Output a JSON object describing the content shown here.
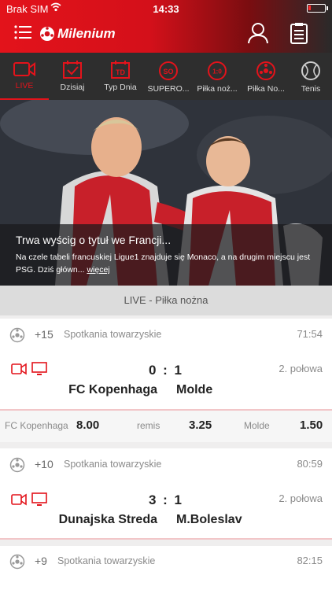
{
  "status": {
    "carrier": "Brak SIM",
    "time": "14:33",
    "battery_level": 0.15
  },
  "header": {
    "logo_text": "Milenium"
  },
  "colors": {
    "brand_red": "#e3131b",
    "dark_bar": "#2e2e2e",
    "card_bg": "#ffffff",
    "muted": "#8a8a8a"
  },
  "categories": [
    {
      "label": "LIVE",
      "icon": "video-camera-icon",
      "active": true
    },
    {
      "label": "Dzisiaj",
      "icon": "calendar-check-icon"
    },
    {
      "label": "Typ Dnia",
      "icon": "calendar-td-icon"
    },
    {
      "label": "SUPERO...",
      "icon": "so-badge-icon"
    },
    {
      "label": "Piłka noż...",
      "icon": "one-zero-badge-icon"
    },
    {
      "label": "Piłka No...",
      "icon": "soccer-ball-icon"
    },
    {
      "label": "Tenis",
      "icon": "tennis-ball-icon"
    }
  ],
  "hero": {
    "headline": "Trwa wyścig o tytuł we Francji...",
    "description": "Na czele tabeli francuskiej Ligue1 znajduje się Monaco, a na drugim miejscu jest PSG. Dziś główn...",
    "more_label": "więcej"
  },
  "section_title": "LIVE - Piłka nożna",
  "matches": [
    {
      "more_bets": "+15",
      "league": "Spotkania towarzyskie",
      "clock": "71:54",
      "score_home": "0",
      "score_away": "1",
      "period": "2. połowa",
      "home": "FC Kopenhaga",
      "away": "Molde"
    },
    {
      "more_bets": "+10",
      "league": "Spotkania towarzyskie",
      "clock": "80:59",
      "score_home": "3",
      "score_away": "1",
      "period": "2. połowa",
      "home": "Dunajska Streda",
      "away": "M.Boleslav"
    },
    {
      "more_bets": "+9",
      "league": "Spotkania towarzyskie",
      "clock": "82:15"
    }
  ],
  "odds": {
    "home_label": "FC Kopenhaga",
    "home_value": "8.00",
    "draw_label": "remis",
    "draw_value": "3.25",
    "away_label": "Molde",
    "away_value": "1.50"
  }
}
